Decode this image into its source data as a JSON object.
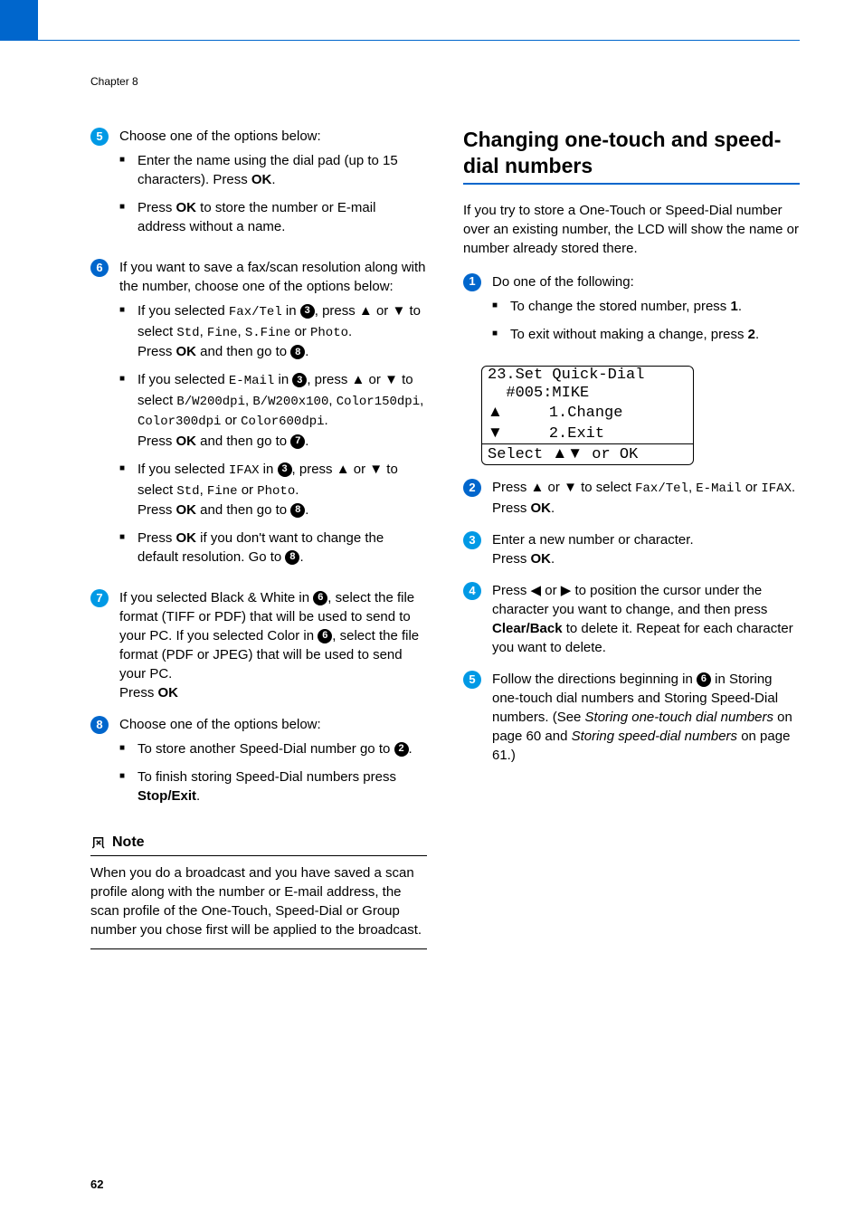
{
  "chapter": "Chapter 8",
  "page_num": "62",
  "left": {
    "step5": {
      "intro": "Choose one of the options below:",
      "b1a": "Enter the name using the dial pad (up to 15 characters). Press ",
      "b1b": "OK",
      "b1c": ".",
      "b2a": "Press ",
      "b2b": "OK",
      "b2c": " to store the number or E-mail address without a name."
    },
    "step6": {
      "intro": "If you want to save a fax/scan resolution along with the number, choose one of the options below:",
      "i1a": "If you selected ",
      "i1b": "Fax/Tel",
      "i1c": " in ",
      "i1d": ", press ",
      "i1e": "a",
      "i1f": " or ",
      "i1g": "b",
      "i1h": " to select ",
      "i1i": "Std",
      "i1j": ", ",
      "i1k": "Fine",
      "i1l": ", ",
      "i1m": "S.Fine",
      "i1n": " or ",
      "i1o": "Photo",
      "i1p": ".",
      "i1q": "Press ",
      "i1r": "OK",
      "i1s": " and then go to ",
      "i1t": ".",
      "i2a": "If you selected ",
      "i2b": "E-Mail",
      "i2c": " in ",
      "i2d": ", press ",
      "i2e": "a",
      "i2f": " or ",
      "i2g": "b",
      "i2h": " to select ",
      "i2i": "B/W200dpi",
      "i2j": ", ",
      "i2k": "B/W200x100",
      "i2l": ", ",
      "i2m": "Color150dpi",
      "i2n": ", ",
      "i2o": "Color300dpi",
      "i2p": " or ",
      "i2q": "Color600dpi",
      "i2r": ".",
      "i2s": "Press ",
      "i2t": "OK",
      "i2u": " and then go to ",
      "i2v": ".",
      "i3a": "If you selected ",
      "i3b": "IFAX",
      "i3c": " in ",
      "i3d": ", press ",
      "i3e": "a",
      "i3f": " or ",
      "i3g": "b",
      "i3h": " to select ",
      "i3i": "Std",
      "i3j": ", ",
      "i3k": "Fine",
      "i3l": " or ",
      "i3m": "Photo",
      "i3n": ".",
      "i3o": "Press ",
      "i3p": "OK",
      "i3q": " and then go to ",
      "i3r": ".",
      "i4a": "Press ",
      "i4b": "OK",
      "i4c": " if you don't want to change the default resolution. Go to ",
      "i4d": "."
    },
    "step7": {
      "a": "If you selected Black & White in ",
      "b": ", select the file format (TIFF or PDF) that will be used to send to your PC. If you selected Color in ",
      "c": ", select the file format (PDF or JPEG) that will be used to send your PC.",
      "d": "Press ",
      "e": "OK"
    },
    "step8": {
      "intro": "Choose one of the options below:",
      "b1a": "To store another Speed-Dial number go to ",
      "b1b": ".",
      "b2a": "To finish storing Speed-Dial numbers press ",
      "b2b": "Stop/Exit",
      "b2c": "."
    },
    "note": {
      "title": "Note",
      "body": "When you do a broadcast and you have saved a scan profile along with the number or E-mail address, the scan profile of the One-Touch, Speed-Dial or Group number you chose first will be applied to the broadcast."
    }
  },
  "right": {
    "title": "Changing one-touch and speed-dial numbers",
    "intro": "If you try to store a One-Touch or Speed-Dial number over an existing number, the LCD will show the name or number already stored there.",
    "step1": {
      "intro": "Do one of the following:",
      "b1a": "To change the stored number, press ",
      "b1b": "1",
      "b1c": ".",
      "b2a": "To exit without making a change, press ",
      "b2b": "2",
      "b2c": "."
    },
    "lcd": {
      "l1": "23.Set Quick-Dial",
      "l2": "  #005:MIKE",
      "l3": "a     1.Change",
      "l4": "b     2.Exit",
      "l5": "Select ab or OK"
    },
    "step2": {
      "a": "Press ",
      "b": "a",
      "c": " or ",
      "d": "b",
      "e": " to select ",
      "f": "Fax/Tel",
      "g": ", ",
      "h": "E-Mail",
      "i": " or ",
      "j": "IFAX",
      "k": ". Press ",
      "l": "OK",
      "m": "."
    },
    "step3": {
      "a": "Enter a new number or character.",
      "b": "Press ",
      "c": "OK",
      "d": "."
    },
    "step4": {
      "a": "Press ",
      "b": "d",
      "c": " or ",
      "d": "c",
      "e": " to position the cursor under the character you want to change, and then press ",
      "f": "Clear/Back",
      "g": " to delete it. Repeat for each character you want to delete."
    },
    "step5": {
      "a": "Follow the directions beginning in ",
      "b": " in Storing one-touch dial numbers and Storing Speed-Dial numbers. (See ",
      "c": "Storing one-touch dial numbers",
      "d": " on page 60 and ",
      "e": "Storing speed-dial numbers",
      "f": " on page 61.)"
    }
  },
  "refs": {
    "r2": "2",
    "r3": "3",
    "r6": "6",
    "r7": "7",
    "r8": "8"
  }
}
